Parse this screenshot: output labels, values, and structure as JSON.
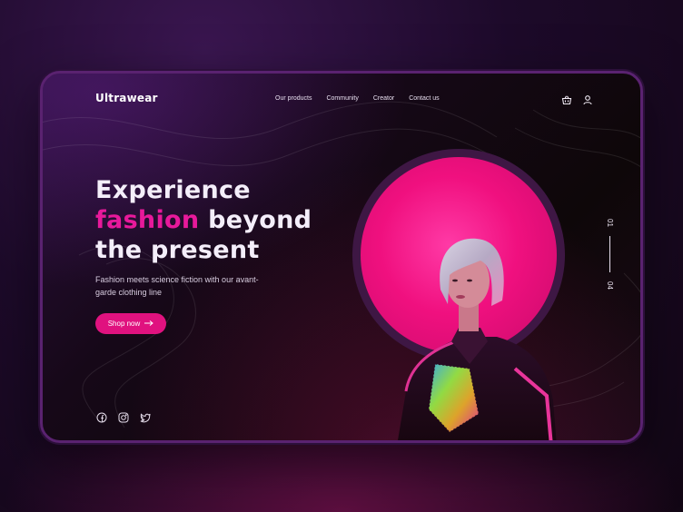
{
  "brand": {
    "logo": "Ultrawear"
  },
  "nav": {
    "items": [
      "Our products",
      "Community",
      "Creator",
      "Contact us"
    ],
    "icons": [
      "basket-icon",
      "user-icon"
    ]
  },
  "hero": {
    "title_line1": "Experience",
    "title_accent": "fashion",
    "title_line2_rest": " beyond",
    "title_line3": "the present",
    "subtitle": "Fashion meets science fiction with our avant-garde clothing line",
    "cta_label": "Shop now",
    "cta_icon": "arrow-right-icon"
  },
  "social": [
    "facebook-icon",
    "instagram-icon",
    "twitter-icon"
  ],
  "pager": {
    "current": "01",
    "total": "04"
  },
  "colors": {
    "accent": "#e0127f",
    "accent_text": "#e8199b",
    "frame_border": "#5a2270",
    "disc": "#f0107f"
  }
}
